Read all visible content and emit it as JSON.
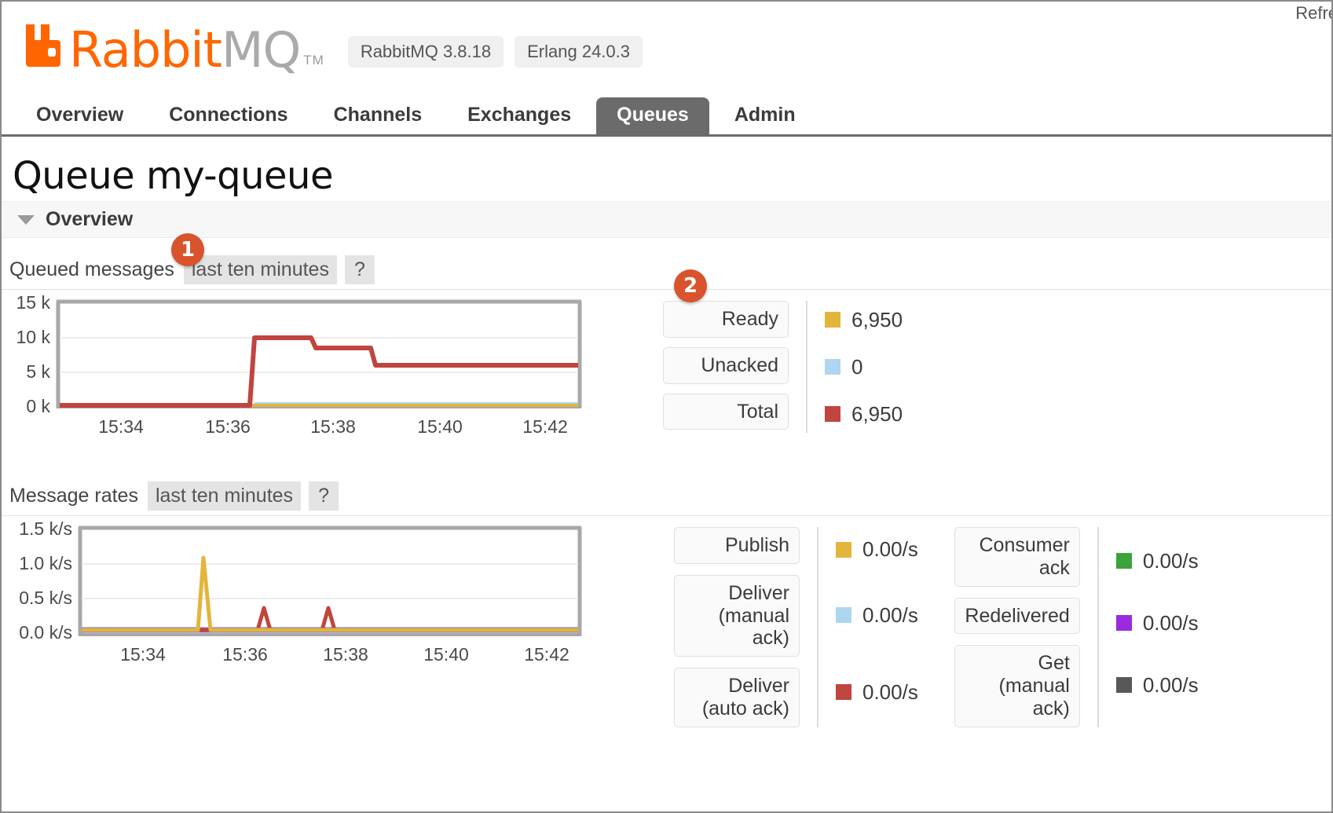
{
  "header": {
    "logo_text_primary": "Rabbit",
    "logo_text_secondary": "MQ",
    "logo_tm": "TM",
    "version_rabbitmq": "RabbitMQ 3.8.18",
    "version_erlang": "Erlang 24.0.3",
    "refresh_text": "Refre"
  },
  "tabs": [
    {
      "label": "Overview",
      "active": false
    },
    {
      "label": "Connections",
      "active": false
    },
    {
      "label": "Channels",
      "active": false
    },
    {
      "label": "Exchanges",
      "active": false
    },
    {
      "label": "Queues",
      "active": true
    },
    {
      "label": "Admin",
      "active": false
    }
  ],
  "page": {
    "title_prefix": "Queue",
    "queue_name": "my-queue",
    "section_overview": "Overview"
  },
  "annotations": [
    {
      "number": "1",
      "target": "queued-messages-period-chip"
    },
    {
      "number": "2",
      "target": "queued-messages-legend"
    }
  ],
  "queued_messages": {
    "label": "Queued messages",
    "period_chip": "last ten minutes",
    "help_chip": "?",
    "legend": [
      {
        "name": "Ready",
        "value": "6,950",
        "color": "#e3b53a"
      },
      {
        "name": "Unacked",
        "value": "0",
        "color": "#aed6f1"
      },
      {
        "name": "Total",
        "value": "6,950",
        "color": "#c0453f"
      }
    ]
  },
  "message_rates": {
    "label": "Message rates",
    "period_chip": "last ten minutes",
    "help_chip": "?",
    "legend_left": [
      {
        "name": "Publish",
        "value": "0.00/s",
        "color": "#e3b53a"
      },
      {
        "name": "Deliver\n(manual\nack)",
        "value": "0.00/s",
        "color": "#aed6f1"
      },
      {
        "name": "Deliver\n(auto ack)",
        "value": "0.00/s",
        "color": "#c0453f"
      }
    ],
    "legend_right": [
      {
        "name": "Consumer\nack",
        "value": "0.00/s",
        "color": "#3aa33a"
      },
      {
        "name": "Redelivered",
        "value": "0.00/s",
        "color": "#9b2bdf"
      },
      {
        "name": "Get\n(manual\nack)",
        "value": "0.00/s",
        "color": "#585858"
      }
    ]
  },
  "chart_data": [
    {
      "type": "line",
      "id": "queued-messages-chart",
      "title": "Queued messages",
      "xlabel": "",
      "ylabel": "",
      "ylim": [
        0,
        15000
      ],
      "yticks": [
        0,
        5000,
        10000,
        15000
      ],
      "ytick_labels": [
        "0 k",
        "5 k",
        "10 k",
        "15 k"
      ],
      "xticks": [
        "15:34",
        "15:36",
        "15:38",
        "15:40",
        "15:42"
      ],
      "xlim": [
        "15:33",
        "15:43"
      ],
      "grid": true,
      "legend_position": "right",
      "series": [
        {
          "name": "Total",
          "color": "#c0453f",
          "x": [
            "15:33.0",
            "15:36.1",
            "15:36.3",
            "15:37.4",
            "15:37.6",
            "15:38.8",
            "15:39.0",
            "15:43.0"
          ],
          "values": [
            0,
            0,
            10200,
            10200,
            8700,
            8700,
            6950,
            6950
          ]
        },
        {
          "name": "Ready",
          "color": "#e3b53a",
          "x": [
            "15:33.0",
            "15:43.0"
          ],
          "values": [
            0,
            0
          ]
        },
        {
          "name": "Unacked",
          "color": "#aed6f1",
          "x": [
            "15:36.2",
            "15:43.0"
          ],
          "values": [
            0,
            0
          ]
        }
      ]
    },
    {
      "type": "line",
      "id": "message-rates-chart",
      "title": "Message rates",
      "xlabel": "",
      "ylabel": "",
      "ylim": [
        0,
        1500
      ],
      "yticks": [
        0,
        500,
        1000,
        1500
      ],
      "ytick_labels": [
        "0.0 k/s",
        "0.5 k/s",
        "1.0 k/s",
        "1.5 k/s"
      ],
      "xticks": [
        "15:34",
        "15:36",
        "15:38",
        "15:40",
        "15:42"
      ],
      "xlim": [
        "15:33",
        "15:43"
      ],
      "grid": true,
      "legend_position": "right",
      "series": [
        {
          "name": "Publish",
          "color": "#e3b53a",
          "x": [
            "15:33.0",
            "15:36.0",
            "15:36.15",
            "15:36.3",
            "15:43.0"
          ],
          "values": [
            0,
            0,
            1110,
            0,
            0
          ]
        },
        {
          "name": "Deliver (auto ack)",
          "color": "#c0453f",
          "x": [
            "15:33.0",
            "15:37.5",
            "15:37.62",
            "15:37.75",
            "15:38.45",
            "15:38.57",
            "15:38.7",
            "15:43.0"
          ],
          "values": [
            0,
            0,
            250,
            0,
            0,
            250,
            0,
            0
          ]
        },
        {
          "name": "Redelivered",
          "color": "#7b6fd0",
          "x": [
            "15:33.0",
            "15:43.0"
          ],
          "values": [
            0,
            0
          ]
        }
      ]
    }
  ]
}
